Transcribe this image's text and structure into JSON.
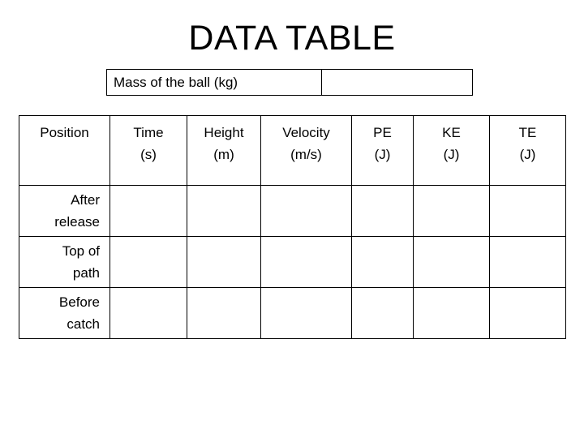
{
  "page": {
    "title": "DATA TABLE",
    "background_color": "#ffffff",
    "text_color": "#000000",
    "border_color": "#000000"
  },
  "mass_box": {
    "label": "Mass of the ball (kg)",
    "value": ""
  },
  "table": {
    "headers": [
      {
        "name": "Position",
        "unit": ""
      },
      {
        "name": "Time",
        "unit": "(s)"
      },
      {
        "name": "Height",
        "unit": "(m)"
      },
      {
        "name": "Velocity",
        "unit": "(m/s)"
      },
      {
        "name": "PE",
        "unit": "(J)"
      },
      {
        "name": "KE",
        "unit": "(J)"
      },
      {
        "name": "TE",
        "unit": "(J)"
      }
    ],
    "rows": [
      {
        "label_line1": "After",
        "label_line2": "release",
        "cells": [
          "",
          "",
          "",
          "",
          "",
          ""
        ]
      },
      {
        "label_line1": "Top of",
        "label_line2": "path",
        "cells": [
          "",
          "",
          "",
          "",
          "",
          ""
        ]
      },
      {
        "label_line1": "Before",
        "label_line2": "catch",
        "cells": [
          "",
          "",
          "",
          "",
          "",
          ""
        ]
      }
    ]
  }
}
